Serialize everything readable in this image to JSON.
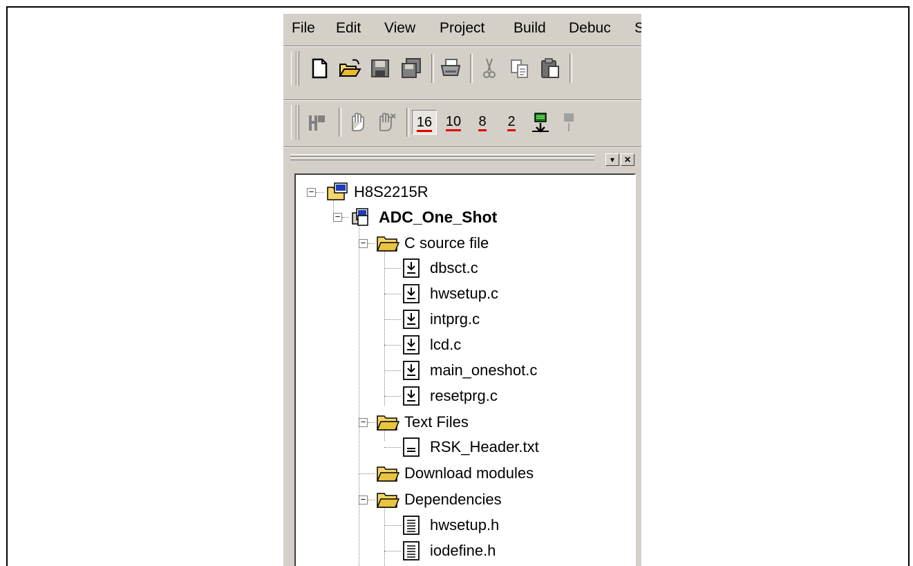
{
  "menu": [
    "File",
    "Edit",
    "View",
    "Project",
    "Build",
    "Debuc",
    "S"
  ],
  "toolbar1": {
    "icons": [
      "new-file-icon",
      "open-folder-icon",
      "save-icon",
      "save-all-icon",
      "print-icon",
      "cut-icon",
      "copy-icon",
      "paste-icon"
    ]
  },
  "toolbar2": {
    "icons": [
      "run-reset-icon",
      "halt-hand-icon",
      "break-hand-icon",
      "radix-hex-icon",
      "radix-dec-icon",
      "radix-oct-icon",
      "radix-bin-icon",
      "download-icon"
    ],
    "radix": [
      "16",
      "10",
      "8",
      "2"
    ]
  },
  "panel": {
    "dropdown_glyph": "▾",
    "close_glyph": "✕"
  },
  "tree": {
    "workspace": "H8S2215R",
    "project": "ADC_One_Shot",
    "folders": {
      "c_source": "C source file",
      "text_files": "Text Files",
      "download_modules": "Download modules",
      "dependencies": "Dependencies"
    },
    "c_files": [
      "dbsct.c",
      "hwsetup.c",
      "intprg.c",
      "lcd.c",
      "main_oneshot.c",
      "resetprg.c"
    ],
    "text_files": [
      "RSK_Header.txt"
    ],
    "dep_files": [
      "hwsetup.h",
      "iodefine.h"
    ]
  },
  "colors": {
    "chrome": "#d4d0c8",
    "radix_underline": "#e00000",
    "folder": "#f5d66b"
  }
}
